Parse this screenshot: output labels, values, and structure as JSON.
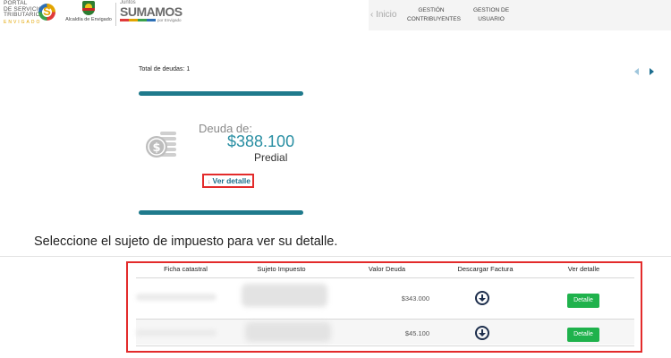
{
  "header": {
    "portal_logo": {
      "line1": "PORTAL",
      "line2": "DE SERVICIOS",
      "line3": "TRIBUTARIOS",
      "sub": "ENVIGADO",
      "mark": "S"
    },
    "alcaldia_label": "Alcaldía de Envigado",
    "juntos_logo": {
      "small": "Juntos",
      "big": "SUMAMOS",
      "tiny": "por Envigado"
    },
    "nav": {
      "inicio": "‹ Inicio",
      "gestion_contribuyentes": [
        "GESTIÓN",
        "CONTRIBUYENTES"
      ],
      "gestion_usuario": "GESTION DE USUARIO"
    }
  },
  "summary": {
    "total_label": "Total de deudas: 1",
    "deuda_label": "Deuda de:",
    "amount": "$388.100",
    "concepto": "Predial",
    "ver_detalle": "Ver detalle",
    "ver_detalle_icon": "↓"
  },
  "seleccione_text": "Seleccione el sujeto de impuesto para ver su detalle.",
  "table": {
    "headers": [
      "Ficha catastral",
      "Sujeto Impuesto",
      "Valor Deuda",
      "Descargar Factura",
      "Ver detalle"
    ],
    "rows": [
      {
        "valor": "$343.000",
        "detalle": "Detalle"
      },
      {
        "valor": "$45.100",
        "detalle": "Detalle"
      }
    ]
  },
  "icons": {
    "coin": "coin-stack-icon",
    "download": "download-circle-icon",
    "arrows": [
      "arrow-left-icon",
      "arrow-right-icon"
    ]
  },
  "colors": {
    "accent": "#1f7a8c",
    "amount": "#2a8fa3",
    "highlight_border": "#e32b2b",
    "button_green": "#1fb24c"
  }
}
